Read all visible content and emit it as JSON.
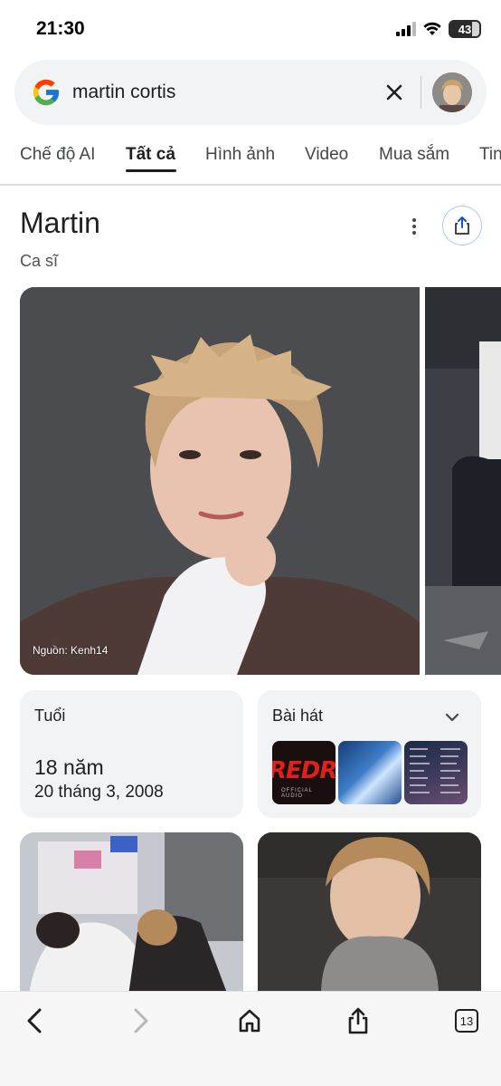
{
  "status_bar": {
    "time": "21:30",
    "battery": "43",
    "icons": [
      "cellular-signal-icon",
      "wifi-icon",
      "battery-icon"
    ]
  },
  "search": {
    "query": "martin cortis",
    "logo": "google-logo",
    "clear_icon": "close-icon"
  },
  "tabs": [
    {
      "label": "Chế độ AI",
      "active": false
    },
    {
      "label": "Tất cả",
      "active": true
    },
    {
      "label": "Hình ảnh",
      "active": false
    },
    {
      "label": "Video",
      "active": false
    },
    {
      "label": "Mua sắm",
      "active": false
    },
    {
      "label": "Tin",
      "active": false
    }
  ],
  "entity": {
    "title": "Martin",
    "subtitle": "Ca sĩ"
  },
  "images": {
    "main_source": "Nguồn: Kenh14"
  },
  "age_card": {
    "label": "Tuổi",
    "value": "18 năm",
    "birthdate": "20 tháng 3, 2008"
  },
  "songs_card": {
    "label": "Bài hát",
    "thumb1_text": "REDRE",
    "thumb1_sub": "OFFICIAL AUDIO"
  },
  "bottom_nav": {
    "tab_count": "13",
    "icons": [
      "back-icon",
      "forward-icon",
      "home-icon",
      "share-icon",
      "tabs-icon"
    ]
  },
  "colors": {
    "accent_border": "#a8c7fa",
    "card_bg": "#f1f3f4",
    "text_primary": "#1f1f1f",
    "text_secondary": "#4d5156"
  }
}
